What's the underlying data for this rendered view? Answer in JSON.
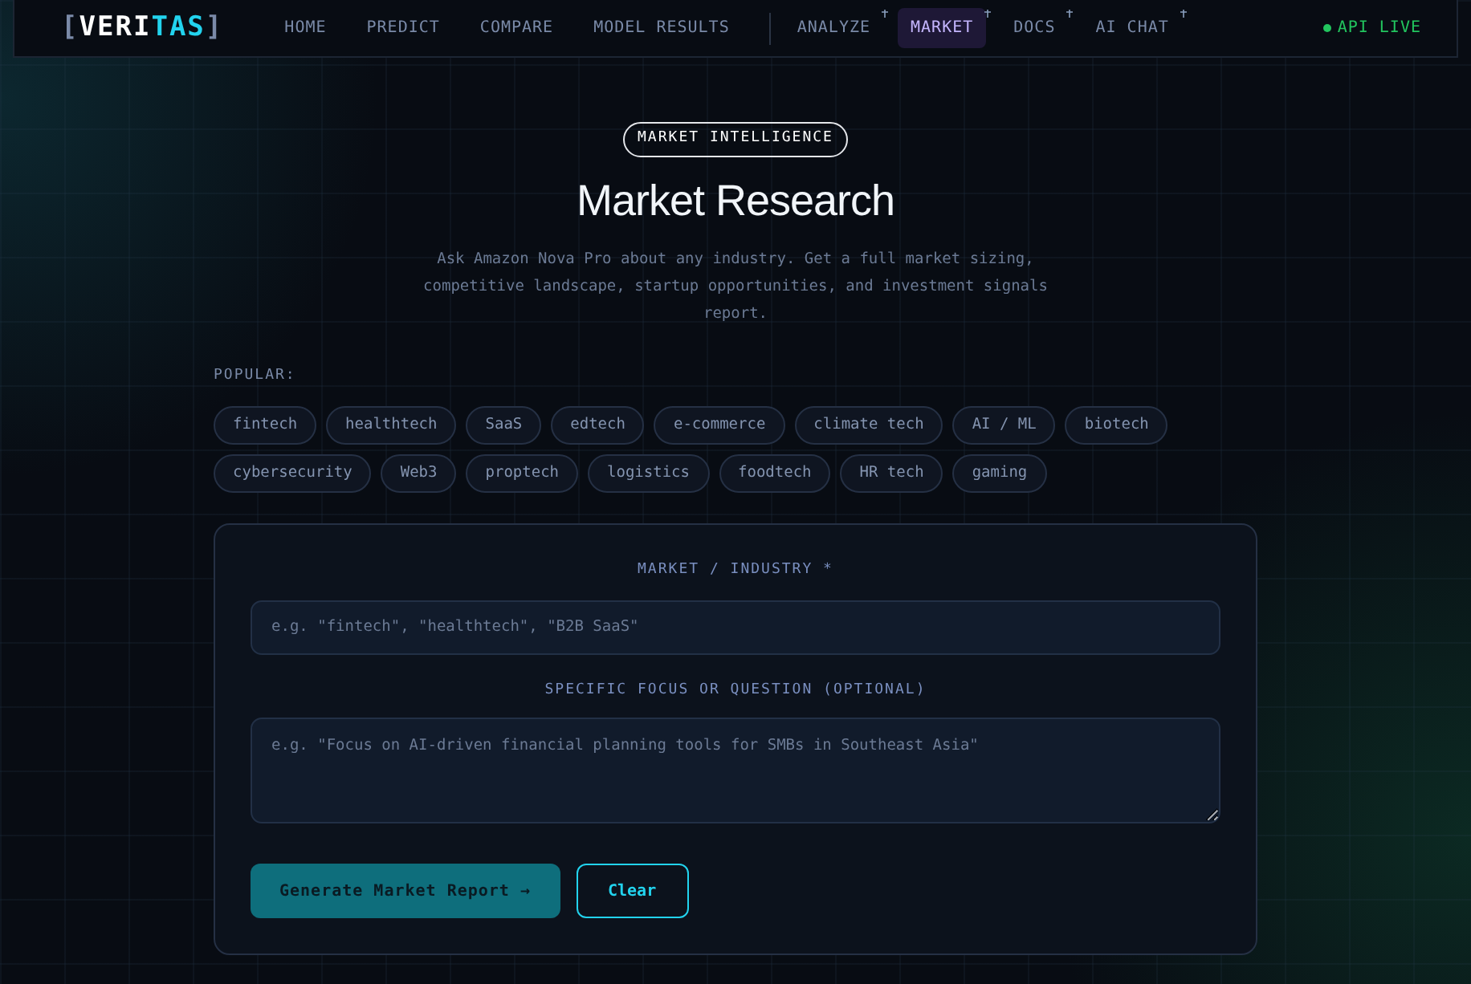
{
  "logo": {
    "open": "[",
    "part_a": "VERI",
    "part_b": "TAS",
    "close": "]"
  },
  "nav": [
    [
      {
        "label": "HOME",
        "selected": false,
        "marked": false
      },
      {
        "label": "PREDICT",
        "selected": false,
        "marked": false
      },
      {
        "label": "COMPARE",
        "selected": false,
        "marked": false
      },
      {
        "label": "MODEL RESULTS",
        "selected": false,
        "marked": false
      }
    ],
    [
      {
        "label": "ANALYZE",
        "selected": false,
        "marked": true
      },
      {
        "label": "MARKET",
        "selected": true,
        "marked": true
      },
      {
        "label": "DOCS",
        "selected": false,
        "marked": true
      },
      {
        "label": "AI CHAT",
        "selected": false,
        "marked": true
      }
    ]
  ],
  "status": {
    "label": "API LIVE",
    "color": "#22c55e"
  },
  "badge": "MARKET INTELLIGENCE",
  "title": "Market Research",
  "subtitle": "Ask Amazon Nova Pro about any industry. Get a full market sizing, competitive landscape, startup opportunities, and investment signals report.",
  "popular": {
    "label": "POPULAR:",
    "rows": [
      [
        "fintech",
        "healthtech",
        "SaaS",
        "edtech",
        "e-commerce",
        "climate tech",
        "AI / ML",
        "biotech"
      ],
      [
        "cybersecurity",
        "Web3",
        "proptech",
        "logistics",
        "foodtech",
        "HR tech",
        "gaming"
      ]
    ]
  },
  "form": {
    "market_label": "MARKET / INDUSTRY *",
    "market_placeholder": "e.g. \"fintech\", \"healthtech\", \"B2B SaaS\"",
    "focus_label": "SPECIFIC FOCUS OR QUESTION (OPTIONAL)",
    "focus_placeholder": "e.g. \"Focus on AI-driven financial planning tools for SMBs in Southeast Asia\"",
    "submit": "Generate Market Report →",
    "clear": "Clear"
  }
}
